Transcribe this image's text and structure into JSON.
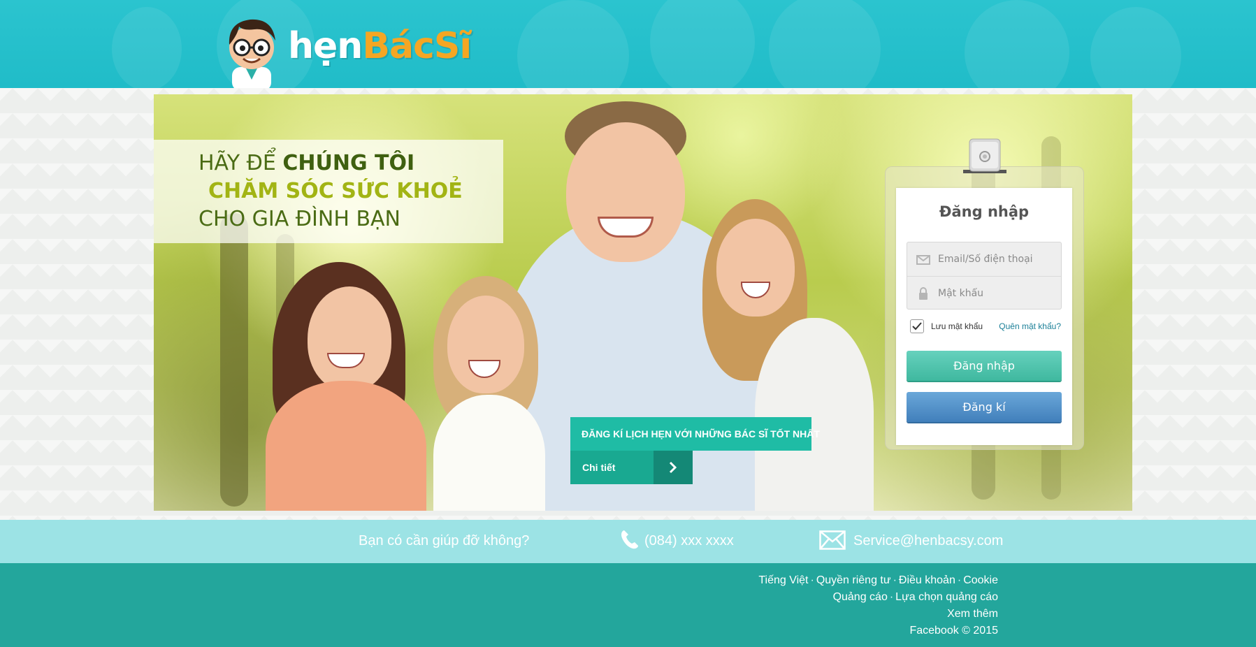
{
  "brand": {
    "hen": "hẹn",
    "bacsi": "BácSĩ"
  },
  "hero": {
    "tagline_line1_regular": "HÃY ĐỂ ",
    "tagline_line1_bold": "CHÚNG TÔI",
    "tagline_line2": "CHĂM SÓC SỨC KHOẺ",
    "tagline_line3": "CHO GIA ĐÌNH BẠN",
    "cta_text": "ĐĂNG KÍ LỊCH HẸN VỚI NHỮNG BÁC SĨ TỐT NHẤT",
    "detail_label": "Chi tiết"
  },
  "login": {
    "title": "Đăng nhập",
    "email_placeholder": "Email/Số điện thoại",
    "password_placeholder": "Mật khẩu",
    "remember_label": "Lưu mật khẩu",
    "remember_checked": true,
    "forgot_label": "Quên mật khẩu?",
    "login_button": "Đăng nhập",
    "register_button": "Đăng kí",
    "login_color": "#4fc2ab",
    "register_color": "#4f8fc8"
  },
  "help": {
    "question": "Bạn có cần giúp đỡ không?",
    "phone": "(084) xxx xxxx",
    "email": "Service@henbacsy.com"
  },
  "footer": {
    "row1": [
      "Tiếng Việt",
      "Quyền riêng tư",
      "Điều khoản",
      "Cookie"
    ],
    "row2": [
      "Quảng cáo",
      "Lựa chọn quảng cáo"
    ],
    "more": "Xem thêm",
    "copyright": "Facebook © 2015"
  },
  "colors": {
    "header": "#20bcc8",
    "help_bar": "#9ce3e5",
    "footer": "#23a69c",
    "accent_orange": "#f5a623"
  }
}
